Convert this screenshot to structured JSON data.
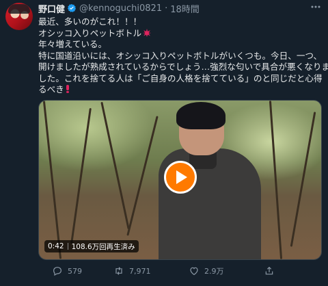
{
  "author": {
    "name": "野口健",
    "handle": "@kennoguchi0821",
    "separator": "·",
    "time": "18時間"
  },
  "more_icon": "more-dots-icon",
  "text": {
    "line1": "最近、多いのがこれ！！！",
    "line2": "オシッコ入りペットボトル",
    "line3": "年々増えている。",
    "p_line1": "特に国道沿いには、オシッコ入りペットボトルがいくつも。今日、一つ、",
    "p_line2": "開けましたが熟成されているからでしょう…強烈な匂いで具合が悪くなりま",
    "p_line3": "した。これを捨てる人は「ご自身の人格を捨てている」のと同じだと心得",
    "p_line4": "るべき"
  },
  "video": {
    "duration": "0:42",
    "views": "108.6万回再生済み",
    "play_icon": "play-icon"
  },
  "actions": {
    "reply_count": "579",
    "retweet_count": "7,971",
    "like_count": "2.9万"
  },
  "colors": {
    "background": "#15202b",
    "text": "#e7e9ea",
    "muted": "#8b98a5",
    "verified": "#1d9bf0",
    "play_button": "#ff7a00"
  }
}
